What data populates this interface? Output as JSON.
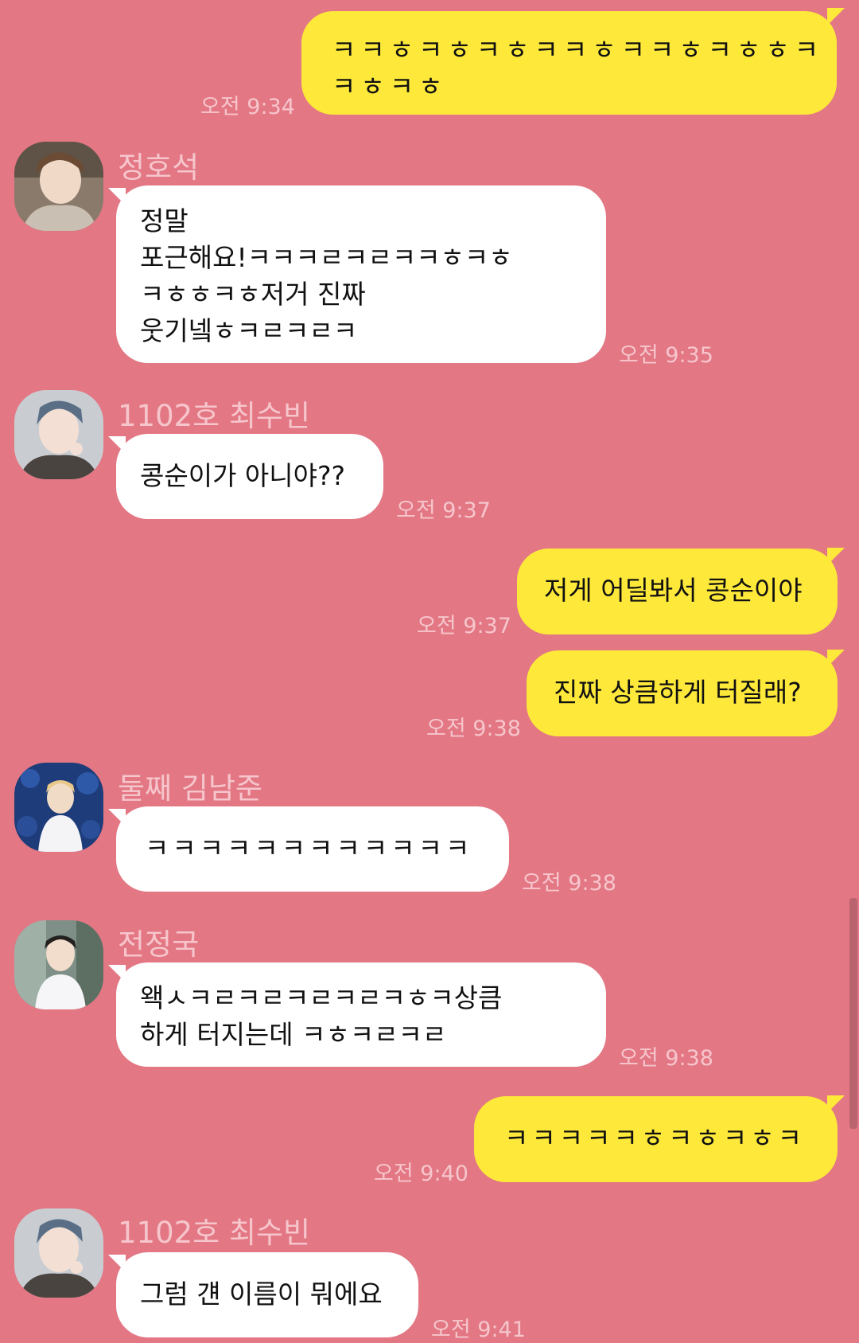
{
  "messages": [
    {
      "sender": "me",
      "text": "ㅋㅋㅎㅋㅎㅋㅎㅋㅋㅎㅋㅋㅎㅋㅎㅎㅋ\nㅋㅎㅋㅎ",
      "time": "오전 9:34"
    },
    {
      "sender": "정호석",
      "text": "정말\n포근해요!ㅋㅋㅋㄹㅋㄹㅋㅋㅎㅋㅎ\nㅋㅎㅎㅋㅎ저거 진짜\n웃기넼ㅎㅋㄹㅋㄹㅋ",
      "time": "오전 9:35",
      "avatar": "avatar-hoseok"
    },
    {
      "sender": "1102호 최수빈",
      "text": "콩순이가 아니야??",
      "time": "오전 9:37",
      "avatar": "avatar-soobin"
    },
    {
      "sender": "me",
      "text": "저게 어딜봐서 콩순이야",
      "time": "오전 9:37"
    },
    {
      "sender": "me",
      "text": "진짜 상큼하게 터질래?",
      "time": "오전 9:38"
    },
    {
      "sender": "둘째 김남준",
      "text": "ㅋㅋㅋㅋㅋㅋㅋㅋㅋㅋㅋㅋ",
      "time": "오전 9:38",
      "avatar": "avatar-namjoon"
    },
    {
      "sender": "전정국",
      "text": "왝ㅅㅋㄹㅋㄹㅋㄹㅋㄹㅋㅎㅋ상큼\n하게 터지는데 ㅋㅎㅋㄹㅋㄹ",
      "time": "오전 9:38",
      "avatar": "avatar-jungkook"
    },
    {
      "sender": "me",
      "text": "ㅋㅋㅋㅋㅋㅎㅋㅎㅋㅎㅋ",
      "time": "오전 9:40"
    },
    {
      "sender": "1102호 최수빈",
      "text": "그럼 걘 이름이 뭐에요",
      "time": "오전 9:41",
      "avatar": "avatar-soobin"
    }
  ],
  "colors": {
    "background": "#e37784",
    "my_bubble": "#fee93b",
    "their_bubble": "#ffffff",
    "meta_text": "#f6c6cc"
  }
}
